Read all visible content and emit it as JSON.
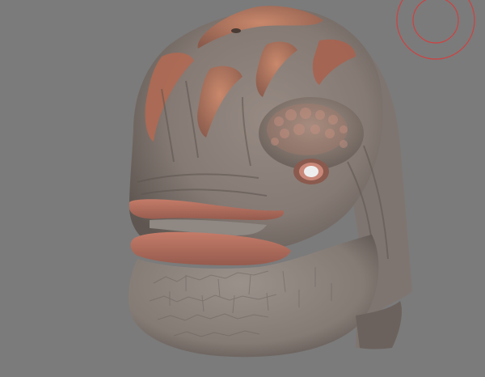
{
  "viewport": {
    "background": "#7b7b7b"
  },
  "subject": {
    "icon": "creature-head-sculpt",
    "skin_color": "#8a7f7a",
    "accent_color": "#c0705a",
    "lip_color": "#b56a5a"
  },
  "overlay": {
    "icon": "view-gizmo-circles",
    "color": "#d04040"
  }
}
